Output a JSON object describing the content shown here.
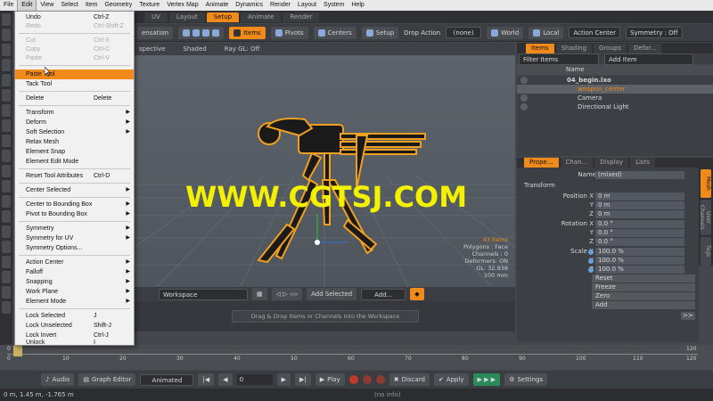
{
  "menubar": {
    "items": [
      "File",
      "Edit",
      "View",
      "Select",
      "Item",
      "Geometry",
      "Texture",
      "Vertex Map",
      "Animate",
      "Dynamics",
      "Render",
      "Layout",
      "System",
      "Help"
    ],
    "active": "Edit"
  },
  "toptabs": [
    "UV",
    "Layout",
    "Setup",
    "Animate",
    "Render"
  ],
  "toptab_active": "Setup",
  "toolbar": {
    "compensation": "ensation",
    "items": "Items",
    "pivots": "Pivots",
    "centers": "Centers",
    "setup": "Setup",
    "drop_action_label": "Drop Action",
    "drop_action_value": "(none)",
    "world": "World",
    "local": "Local",
    "action_center": "Action Center",
    "symmetry": "Symmetry : Off"
  },
  "viewport": {
    "header_view": "spective",
    "header_shading": "Shaded",
    "header_raygl": "Ray GL: Off",
    "watermark": "WWW.CGTSJ.COM",
    "stats": [
      "43 Items",
      "Polygons : Face",
      "Channels : 0",
      "Deformers: ON",
      "GL: 32,938",
      "100 mm"
    ]
  },
  "workspace": {
    "selector": "Workspace",
    "add_selected": "Add Selected",
    "add": "Add...",
    "drop_hint": "Drag & Drop Items or Channels into the Workspace"
  },
  "items_panel": {
    "tabs": [
      "Items",
      "Shading",
      "Groups",
      "Defor..."
    ],
    "filter": "Filter Items",
    "add_item": "Add Item",
    "name_header": "Name",
    "rows": [
      "04_begin.lxo",
      "weapon_center",
      "Camera",
      "Directional Light"
    ]
  },
  "properties": {
    "tabs": [
      "Prope...",
      "Chan...",
      "Display",
      "Lists"
    ],
    "name_label": "Name",
    "name_value": "(mixed)",
    "section": "Transform",
    "position_label": "Position",
    "rotation_label": "Rotation",
    "scale_label": "Scale",
    "axes": [
      "X",
      "Y",
      "Z"
    ],
    "position": [
      "0 m",
      "0 m",
      "0 m"
    ],
    "rotation": [
      "0.0 °",
      "0.0 °",
      "0.0 °"
    ],
    "scale": [
      "100.0 %",
      "100.0 %",
      "100.0 %"
    ],
    "buttons": [
      "Reset",
      "Freeze",
      "Zero",
      "Add"
    ],
    "more": ">>",
    "side_tabs": [
      "Mesh",
      "User Channels",
      "Tags"
    ]
  },
  "timeline": {
    "ticks": [
      "0",
      "10",
      "20",
      "30",
      "40",
      "50",
      "60",
      "70",
      "80",
      "90",
      "100",
      "110",
      "120"
    ],
    "lower_ticks": [
      "0",
      "120"
    ]
  },
  "transport": {
    "audio": "Audio",
    "graph_editor": "Graph Editor",
    "animated": "Animated",
    "frame": "0",
    "play": "Play",
    "discard": "Discard",
    "apply": "Apply",
    "settings": "Settings"
  },
  "status": {
    "coords": "0 m, 1.45 m, -1.765 m",
    "info": "(no info)"
  },
  "edit_menu": [
    {
      "label": "Undo",
      "sc": "Ctrl-Z"
    },
    {
      "label": "Redo",
      "sc": "Ctrl-Shift-Z"
    },
    {
      "label": "Cut",
      "sc": "Ctrl-X"
    },
    {
      "label": "Copy",
      "sc": "Ctrl-C"
    },
    {
      "label": "Paste",
      "sc": "Ctrl-V"
    },
    {
      "label": "Paste Tool",
      "sc": ""
    },
    {
      "label": "Tack Tool",
      "sc": ""
    },
    {
      "label": "Delete",
      "sc": "Delete"
    },
    {
      "label": "Transform",
      "sc": ""
    },
    {
      "label": "Deform",
      "sc": ""
    },
    {
      "label": "Soft Selection",
      "sc": ""
    },
    {
      "label": "Relax Mesh",
      "sc": ""
    },
    {
      "label": "Element Snap",
      "sc": ""
    },
    {
      "label": "Element Edit Mode",
      "sc": ""
    },
    {
      "label": "Reset Tool Attributes",
      "sc": "Ctrl-D"
    },
    {
      "label": "Center Selected",
      "sc": ""
    },
    {
      "label": "Center to Bounding Box",
      "sc": ""
    },
    {
      "label": "Pivot to Bounding Box",
      "sc": ""
    },
    {
      "label": "Symmetry",
      "sc": ""
    },
    {
      "label": "Symmetry for UV",
      "sc": ""
    },
    {
      "label": "Symmetry Options...",
      "sc": ""
    },
    {
      "label": "Action Center",
      "sc": ""
    },
    {
      "label": "Falloff",
      "sc": ""
    },
    {
      "label": "Snapping",
      "sc": ""
    },
    {
      "label": "Work Plane",
      "sc": ""
    },
    {
      "label": "Element Mode",
      "sc": ""
    },
    {
      "label": "Lock Selected",
      "sc": "J"
    },
    {
      "label": "Lock Unselected",
      "sc": "Shift-J"
    },
    {
      "label": "Lock Invert",
      "sc": "Ctrl-J"
    },
    {
      "label": "Unlock",
      "sc": "I"
    }
  ],
  "colors": {
    "accent": "#f08a1a",
    "model_outline": "#f0a020",
    "watermark": "#f3f000"
  }
}
